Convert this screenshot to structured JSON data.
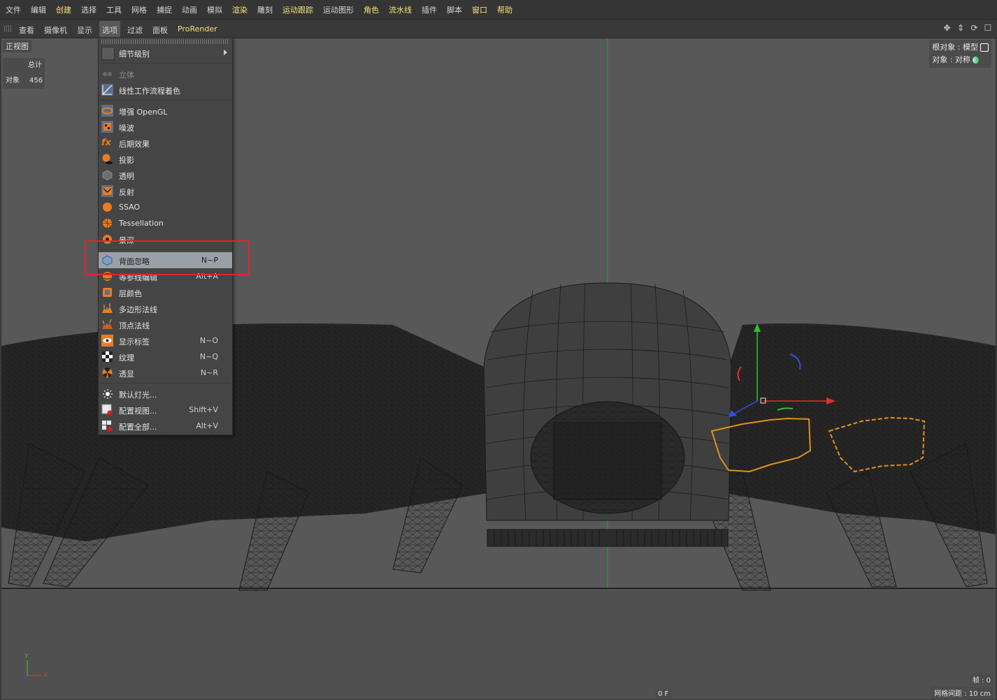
{
  "menubar": {
    "items": [
      {
        "label": "文件",
        "highlight": false
      },
      {
        "label": "编辑",
        "highlight": false
      },
      {
        "label": "创建",
        "highlight": true
      },
      {
        "label": "选择",
        "highlight": false
      },
      {
        "label": "工具",
        "highlight": false
      },
      {
        "label": "网格",
        "highlight": false
      },
      {
        "label": "捕捉",
        "highlight": false
      },
      {
        "label": "动画",
        "highlight": false
      },
      {
        "label": "模拟",
        "highlight": false
      },
      {
        "label": "渲染",
        "highlight": true
      },
      {
        "label": "雕刻",
        "highlight": false
      },
      {
        "label": "运动跟踪",
        "highlight": true
      },
      {
        "label": "运动图形",
        "highlight": false
      },
      {
        "label": "角色",
        "highlight": true
      },
      {
        "label": "流水线",
        "highlight": true
      },
      {
        "label": "插件",
        "highlight": false
      },
      {
        "label": "脚本",
        "highlight": false
      },
      {
        "label": "窗口",
        "highlight": true
      },
      {
        "label": "帮助",
        "highlight": true
      }
    ]
  },
  "view_toolbar": {
    "items": [
      "查看",
      "摄像机",
      "显示",
      "选项",
      "过滤",
      "面板"
    ],
    "active": "选项",
    "prorender": "ProRender"
  },
  "viewport": {
    "name": "正视图",
    "hud": {
      "header": "总计",
      "row_label": "对象",
      "row_value": "456"
    },
    "root_object": "根对象 : 模型",
    "object": "对象 : 对称",
    "frame_label": "帧 : 0",
    "grid_spacing": "网格间距 : 10 cm",
    "frame_counter": "0 F",
    "axis": {
      "y": "Y",
      "x": "X"
    }
  },
  "options_menu": {
    "items": [
      {
        "label": "细节级别",
        "shortcut": "",
        "icon": "detail-level-icon",
        "submenu": true,
        "disabled": false,
        "selected": false
      },
      {
        "label": "立体",
        "shortcut": "",
        "icon": "stereo-icon",
        "disabled": true,
        "selected": false
      },
      {
        "label": "线性工作流程着色",
        "shortcut": "",
        "icon": "linear-workflow-icon",
        "disabled": false,
        "selected": false
      },
      {
        "label": "增强 OpenGL",
        "shortcut": "",
        "icon": "enhanced-opengl-icon",
        "disabled": false,
        "selected": false
      },
      {
        "label": "噪波",
        "shortcut": "",
        "icon": "noise-icon",
        "disabled": false,
        "selected": false
      },
      {
        "label": "后期效果",
        "shortcut": "",
        "icon": "post-effects-icon",
        "disabled": false,
        "selected": false
      },
      {
        "label": "投影",
        "shortcut": "",
        "icon": "shadow-icon",
        "disabled": false,
        "selected": false
      },
      {
        "label": "透明",
        "shortcut": "",
        "icon": "transparency-icon",
        "disabled": false,
        "selected": false
      },
      {
        "label": "反射",
        "shortcut": "",
        "icon": "reflection-icon",
        "disabled": false,
        "selected": false
      },
      {
        "label": "SSAO",
        "shortcut": "",
        "icon": "ssao-icon",
        "disabled": false,
        "selected": false
      },
      {
        "label": "Tessellation",
        "shortcut": "",
        "icon": "tessellation-icon",
        "disabled": false,
        "selected": false
      },
      {
        "label": "景深",
        "shortcut": "",
        "icon": "depth-of-field-icon",
        "disabled": false,
        "selected": false
      },
      {
        "label": "背面忽略",
        "shortcut": "N~P",
        "icon": "backface-culling-icon",
        "disabled": false,
        "selected": true
      },
      {
        "label": "等参线编辑",
        "shortcut": "Alt+A",
        "icon": "isoline-edit-icon",
        "disabled": false,
        "selected": false
      },
      {
        "label": "层颜色",
        "shortcut": "",
        "icon": "layer-color-icon",
        "disabled": false,
        "selected": false
      },
      {
        "label": "多边形法线",
        "shortcut": "",
        "icon": "polygon-normals-icon",
        "disabled": false,
        "selected": false
      },
      {
        "label": "顶点法线",
        "shortcut": "",
        "icon": "vertex-normals-icon",
        "disabled": false,
        "selected": false
      },
      {
        "label": "显示标签",
        "shortcut": "N~O",
        "icon": "show-tags-icon",
        "disabled": false,
        "selected": false
      },
      {
        "label": "纹理",
        "shortcut": "N~Q",
        "icon": "texture-icon",
        "disabled": false,
        "selected": false
      },
      {
        "label": "透显",
        "shortcut": "N~R",
        "icon": "x-ray-icon",
        "disabled": false,
        "selected": false
      },
      {
        "label": "默认灯光...",
        "shortcut": "",
        "icon": "default-light-icon",
        "disabled": false,
        "selected": false
      },
      {
        "label": "配置视图...",
        "shortcut": "Shift+V",
        "icon": "configure-view-icon",
        "disabled": false,
        "selected": false
      },
      {
        "label": "配置全部...",
        "shortcut": "Alt+V",
        "icon": "configure-all-icon",
        "disabled": false,
        "selected": false
      }
    ]
  },
  "colors": {
    "accent_yellow": "#f3e07a",
    "highlight_box": "#e0252b",
    "selection_orange": "#e0901e",
    "axis_x": "#e03030",
    "axis_y": "#30c030",
    "axis_z": "#3050e0"
  }
}
